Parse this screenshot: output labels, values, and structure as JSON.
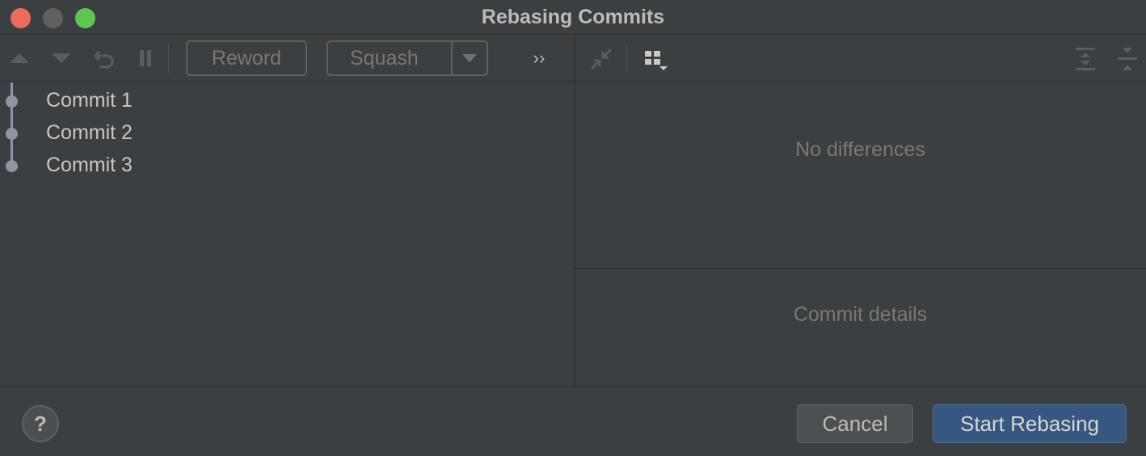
{
  "window": {
    "title": "Rebasing Commits"
  },
  "toolbar": {
    "reword_label": "Reword",
    "squash_label": "Squash",
    "overflow_label": "››",
    "icons": [
      "move-up-icon",
      "move-down-icon",
      "undo-icon",
      "pause-icon",
      "collapse-icon",
      "group-by-icon",
      "expand-all-icon",
      "collapse-all-icon"
    ]
  },
  "commits": [
    {
      "label": "Commit 1"
    },
    {
      "label": "Commit 2"
    },
    {
      "label": "Commit 3"
    }
  ],
  "diff_pane": {
    "empty_text": "No differences"
  },
  "details_pane": {
    "empty_text": "Commit details"
  },
  "footer": {
    "help_label": "?",
    "cancel_label": "Cancel",
    "start_label": "Start Rebasing"
  },
  "colors": {
    "background": "#3c3f41",
    "accent_button": "#365880",
    "graph": "#8c97a2",
    "close": "#ec6a5e",
    "maximize": "#61c554"
  }
}
